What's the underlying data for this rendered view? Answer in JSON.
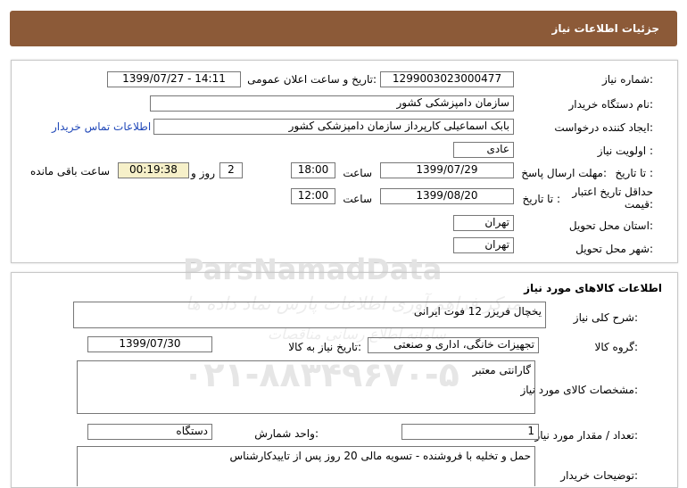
{
  "header": {
    "title": "جزئیات اطلاعات نیاز"
  },
  "details": {
    "need_number_label": "شماره نیاز:",
    "need_number": "1299003023000477",
    "announce_label": "تاریخ و ساعت اعلان عمومی:",
    "announce_value": "1399/07/27 - 14:11",
    "buyer_org_label": "نام دستگاه خریدار:",
    "buyer_org": "سازمان دامپزشکی کشور",
    "requester_label": "ایجاد کننده درخواست:",
    "requester": "بابک اسماعیلی کارپرداز سازمان دامپزشکی کشور",
    "contact_link": "اطلاعات تماس خریدار",
    "priority_label": "اولویت نیاز :",
    "priority": "عادی",
    "reply_deadline_label": "مهلت ارسال پاسخ:",
    "to_date_label": "تا تاریخ :",
    "reply_date": "1399/07/29",
    "time_label": "ساعت",
    "reply_time": "18:00",
    "days": "2",
    "days_label": "روز و",
    "remaining_time": "00:19:38",
    "remaining_label": "ساعت باقی مانده",
    "price_validity_label": "حداقل تاریخ اعتبار قیمت:",
    "validity_date": "1399/08/20",
    "validity_time": "12:00",
    "province_label": "استان محل تحویل:",
    "province": "تهران",
    "city_label": "شهر محل تحویل:",
    "city": "تهران"
  },
  "goods": {
    "section_title": "اطلاعات کالاهای مورد نیاز",
    "description_label": "شرح کلی نیاز:",
    "description": "یخچال فریزر 12 فوت ایرانی",
    "group_label": "گروه کالا:",
    "group": "تجهیزات خانگی، اداری و صنعتی",
    "need_date_label": "تاریخ نیاز به کالا:",
    "need_date": "1399/07/30",
    "specs_label": "مشخصات کالای مورد نیاز:",
    "specs": "گارانتی معتبر",
    "quantity_label": "تعداد / مقدار مورد نیاز:",
    "quantity": "1",
    "unit_label": "واحد شمارش:",
    "unit": "دستگاه",
    "buyer_notes_label": "توضیحات خریدار:",
    "buyer_notes": "حمل و تخلیه با فروشنده - تسویه مالی 20 روز پس از تاییدکارشناس"
  },
  "watermark": {
    "brand": "ParsNamadData",
    "tagline": "مرکز فراهم آوری اطلاعات پارس نماد داده ها",
    "tagline2": "سامانه اطلاع رسانی مناقصات",
    "phone": "۰۲۱-۸۸۳۴۹۶۷۰-۵"
  },
  "colors": {
    "header_bg": "#8c5a38",
    "remaining_bg": "#f6f0c9",
    "link": "#1f47b8"
  }
}
